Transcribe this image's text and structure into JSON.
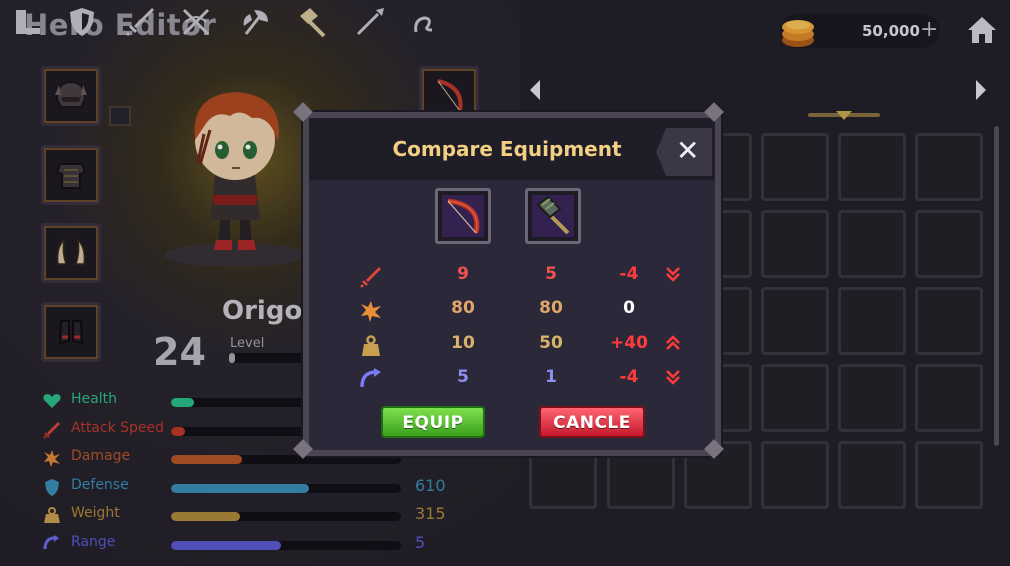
{
  "app": {
    "title": "Hero Editor"
  },
  "currency": {
    "amount": "50,000",
    "plus_label": "+"
  },
  "hero": {
    "name": "Origo",
    "level": "24",
    "level_label": "Level",
    "level_progress": 0.08
  },
  "stats": [
    {
      "label": "Health",
      "value": "",
      "color": "#2bbf8a",
      "fill": 0.1,
      "icon": "heart-icon"
    },
    {
      "label": "Attack Speed",
      "value": "",
      "color": "#c0392b",
      "fill": 0.06,
      "icon": "sword-icon"
    },
    {
      "label": "Damage",
      "value": "",
      "color": "#b5572b",
      "fill": 0.31,
      "icon": "burst-icon"
    },
    {
      "label": "Defense",
      "value": "610",
      "color": "#3a8fb7",
      "fill": 0.6,
      "icon": "shield-icon"
    },
    {
      "label": "Weight",
      "value": "315",
      "color": "#b08a3a",
      "fill": 0.3,
      "icon": "weight-icon"
    },
    {
      "label": "Range",
      "value": "5",
      "color": "#5a5bd1",
      "fill": 0.48,
      "icon": "range-icon"
    }
  ],
  "tabs": [
    {
      "icon": "boot-icon"
    },
    {
      "icon": "shield-icon"
    },
    {
      "icon": "sword-icon"
    },
    {
      "icon": "crossbow-icon"
    },
    {
      "icon": "axe-icon"
    },
    {
      "icon": "hammer-icon",
      "active": true
    },
    {
      "icon": "spear-icon"
    },
    {
      "icon": "whip-icon"
    }
  ],
  "modal": {
    "title": "Compare Equipment",
    "close_label": "✕",
    "equip_label": "EQUIP",
    "cancel_label": "CANCLE",
    "rows": [
      {
        "icon": "sword-icon",
        "a": "9",
        "b": "5",
        "diff": "-4",
        "trend": "down",
        "a_color": "#ef5350",
        "diff_color": "#ff3b3b"
      },
      {
        "icon": "burst-icon",
        "a": "80",
        "b": "80",
        "diff": "0",
        "trend": "none",
        "a_color": "#e0a76a",
        "diff_color": "#ffffff"
      },
      {
        "icon": "weight-icon",
        "a": "10",
        "b": "50",
        "diff": "+40",
        "trend": "up",
        "a_color": "#d9b36a",
        "diff_color": "#ff3b3b"
      },
      {
        "icon": "range-icon",
        "a": "5",
        "b": "1",
        "diff": "-4",
        "trend": "down",
        "a_color": "#8d8ef0",
        "diff_color": "#ff3b3b"
      }
    ]
  }
}
